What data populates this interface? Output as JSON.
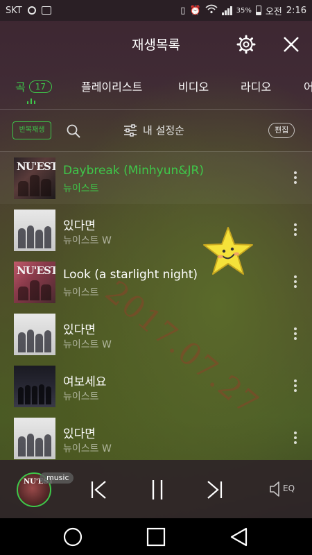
{
  "status_bar": {
    "carrier": "SKT",
    "battery": "35%",
    "ampm": "오전",
    "time": "2:16"
  },
  "header": {
    "title": "재생목록",
    "icons": [
      "gear-icon",
      "close-icon"
    ]
  },
  "tabs": [
    {
      "label": "곡",
      "badge": "17",
      "active": true
    },
    {
      "label": "플레이리스트",
      "active": false
    },
    {
      "label": "비디오",
      "active": false
    },
    {
      "label": "라디오",
      "active": false
    },
    {
      "label": "어",
      "active": false
    }
  ],
  "toolbar": {
    "repeat_label": "반복재생",
    "sort_label": "내 설정순",
    "edit_label": "편집"
  },
  "songs": [
    {
      "title": "Daybreak (Minhyun&JR)",
      "artist": "뉴이스트",
      "art": "nuest-red",
      "playing": true
    },
    {
      "title": "있다면",
      "artist": "뉴이스트 W",
      "art": "nuest-w-white",
      "playing": false
    },
    {
      "title": "Look (a starlight night)",
      "artist": "뉴이스트",
      "art": "nuest-pink",
      "playing": false
    },
    {
      "title": "있다면",
      "artist": "뉴이스트 W",
      "art": "nuest-w-white",
      "playing": false
    },
    {
      "title": "여보세요",
      "artist": "뉴이스트",
      "art": "nuest-dark",
      "playing": false
    },
    {
      "title": "있다면",
      "artist": "뉴이스트 W",
      "art": "nuest-w-white",
      "playing": false
    }
  ],
  "album_stamp": "NU'EST",
  "watermark": "2017.07.27",
  "player": {
    "badge": "music",
    "eq_label": "EQ",
    "icons": [
      "previous-icon",
      "pause-icon",
      "next-icon",
      "speaker-eq-icon"
    ]
  },
  "colors": {
    "accent": "#3ec84a",
    "status_bar": "#2a1f25",
    "player_bar": "#2d2328"
  }
}
